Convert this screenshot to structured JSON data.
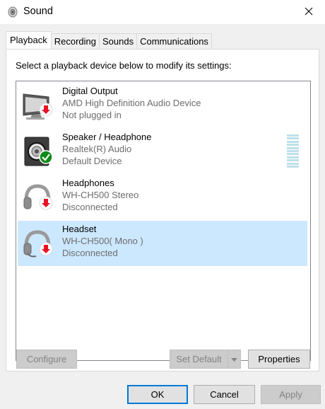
{
  "window": {
    "title": "Sound",
    "icon": "speaker-icon",
    "close_icon": "close-icon"
  },
  "tabs": [
    {
      "label": "Playback",
      "active": true
    },
    {
      "label": "Recording",
      "active": false
    },
    {
      "label": "Sounds",
      "active": false
    },
    {
      "label": "Communications",
      "active": false
    }
  ],
  "playback": {
    "prompt": "Select a playback device below to modify its settings:",
    "devices": [
      {
        "name": "Digital Output",
        "description": "AMD High Definition Audio Device",
        "status": "Not plugged in",
        "icon": "monitor-icon",
        "badge": "red-down-arrow-badge",
        "selected": false
      },
      {
        "name": "Speaker / Headphone",
        "description": "Realtek(R) Audio",
        "status": "Default Device",
        "icon": "speaker-icon",
        "badge": "green-check-badge",
        "selected": false,
        "has_level_meter": true
      },
      {
        "name": "Headphones",
        "description": "WH-CH500 Stereo",
        "status": "Disconnected",
        "icon": "headphones-icon",
        "badge": "red-down-arrow-badge",
        "selected": false
      },
      {
        "name": "Headset",
        "description": "WH-CH500( Mono )",
        "status": "Disconnected",
        "icon": "headset-icon",
        "badge": "red-down-arrow-badge",
        "selected": true
      }
    ],
    "buttons": {
      "configure": "Configure",
      "set_default": "Set Default",
      "properties": "Properties"
    }
  },
  "dialog_buttons": {
    "ok": "OK",
    "cancel": "Cancel",
    "apply": "Apply"
  },
  "colors": {
    "selection": "#cce8ff",
    "accent": "#0078d7",
    "status_red": "#e81123",
    "status_green": "#0e8a16"
  }
}
